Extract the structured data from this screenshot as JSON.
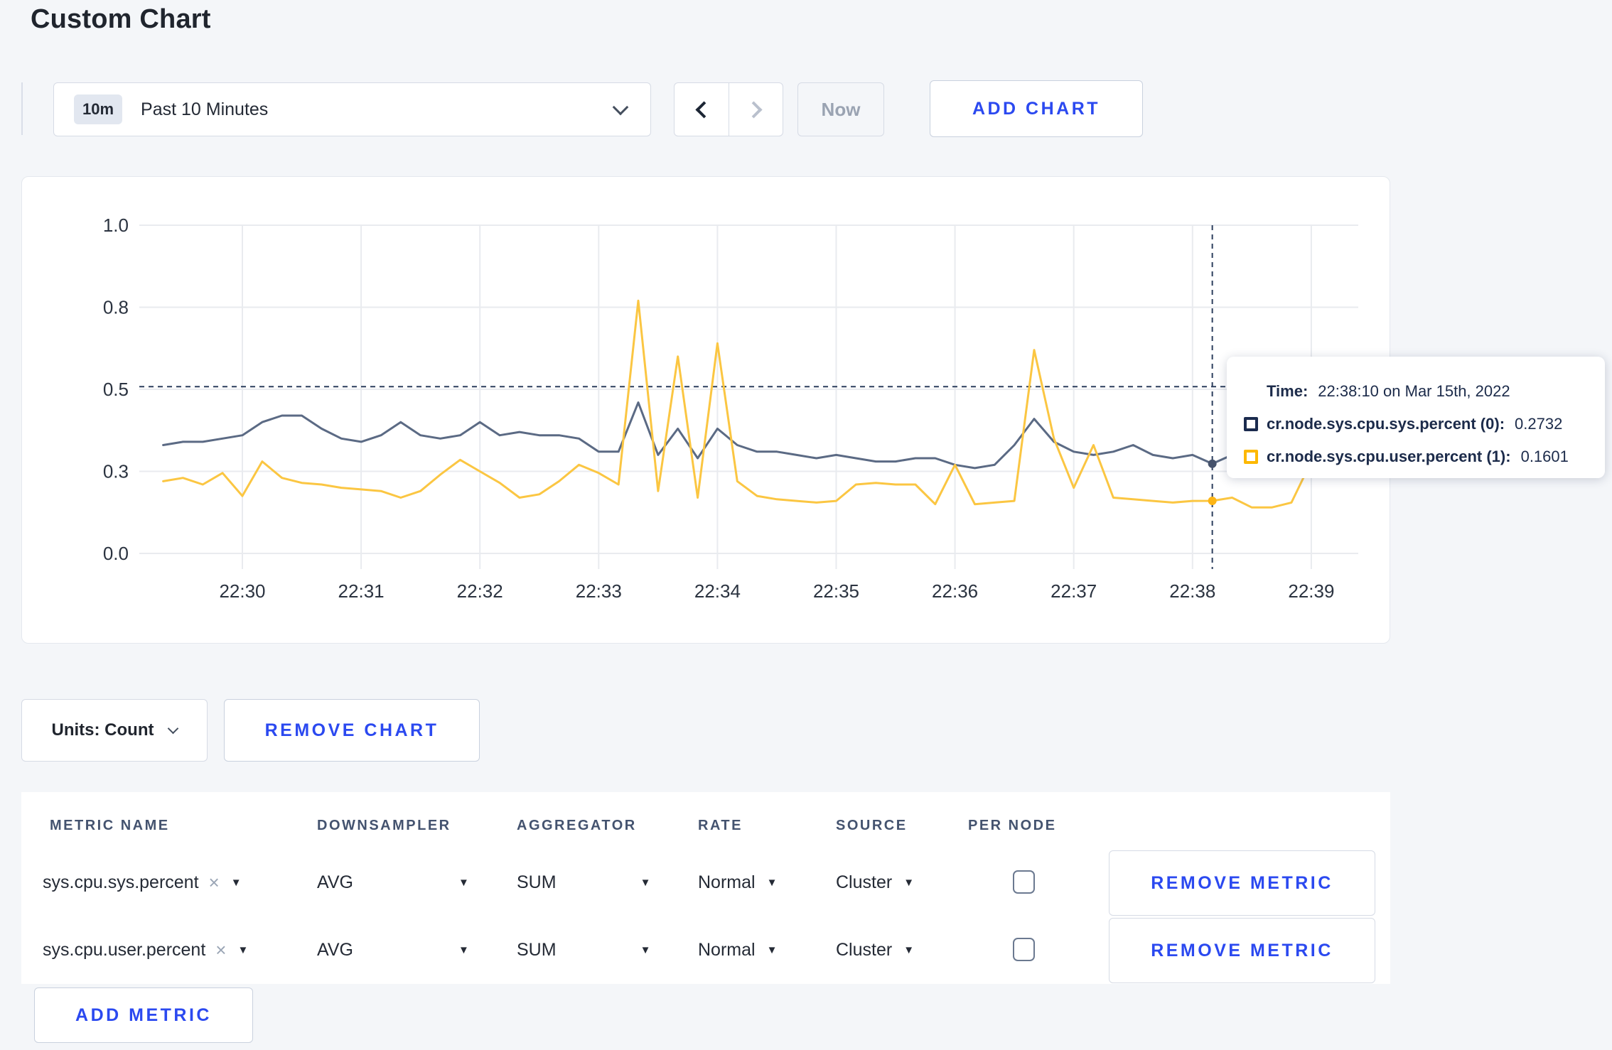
{
  "page": {
    "title": "Custom Chart"
  },
  "toolbar": {
    "time_window_badge": "10m",
    "time_window_label": "Past 10 Minutes",
    "now_label": "Now",
    "add_chart_label": "ADD CHART"
  },
  "chart_data": {
    "type": "line",
    "title": "",
    "xlabel": "",
    "ylabel": "",
    "x_start_label": "22:29:20",
    "x_interval_seconds": 10,
    "x_tick_labels": [
      "22:30",
      "22:31",
      "22:32",
      "22:33",
      "22:34",
      "22:35",
      "22:36",
      "22:37",
      "22:38",
      "22:39"
    ],
    "y_ticks": [
      0,
      0.25,
      0.5,
      0.75,
      1.0
    ],
    "y_tick_labels": [
      "0.0",
      "0.3",
      "0.5",
      "0.8",
      "1.0"
    ],
    "ylim": [
      0,
      1.0
    ],
    "grid": true,
    "series": [
      {
        "name": "cr.node.sys.cpu.sys.percent (0)",
        "color": "#5b6a84",
        "values": [
          0.33,
          0.34,
          0.34,
          0.35,
          0.36,
          0.4,
          0.42,
          0.42,
          0.38,
          0.35,
          0.34,
          0.36,
          0.4,
          0.36,
          0.35,
          0.36,
          0.4,
          0.36,
          0.37,
          0.36,
          0.36,
          0.35,
          0.31,
          0.31,
          0.46,
          0.3,
          0.38,
          0.29,
          0.38,
          0.33,
          0.31,
          0.31,
          0.3,
          0.29,
          0.3,
          0.29,
          0.28,
          0.28,
          0.29,
          0.29,
          0.27,
          0.26,
          0.27,
          0.33,
          0.41,
          0.34,
          0.31,
          0.3,
          0.31,
          0.33,
          0.3,
          0.29,
          0.3,
          0.2732,
          0.3,
          0.32,
          0.3,
          0.3,
          0.31,
          0.3
        ]
      },
      {
        "name": "cr.node.sys.cpu.user.percent (1)",
        "color": "#fbc642",
        "values": [
          0.22,
          0.23,
          0.21,
          0.245,
          0.175,
          0.28,
          0.23,
          0.215,
          0.21,
          0.2,
          0.195,
          0.19,
          0.17,
          0.19,
          0.24,
          0.285,
          0.25,
          0.215,
          0.17,
          0.18,
          0.22,
          0.27,
          0.245,
          0.21,
          0.77,
          0.19,
          0.6,
          0.17,
          0.64,
          0.22,
          0.175,
          0.165,
          0.16,
          0.155,
          0.16,
          0.21,
          0.215,
          0.21,
          0.21,
          0.15,
          0.27,
          0.15,
          0.155,
          0.16,
          0.62,
          0.35,
          0.2,
          0.33,
          0.17,
          0.165,
          0.16,
          0.155,
          0.16,
          0.1601,
          0.17,
          0.14,
          0.14,
          0.155,
          0.28,
          0.24
        ]
      }
    ],
    "crosshair": {
      "x_index": 53,
      "x_time": "22:38:10",
      "hover_y_value": 0.508,
      "dot_values": [
        0.2732,
        0.1601
      ]
    }
  },
  "tooltip": {
    "time_label": "Time:",
    "time_value": "22:38:10 on Mar 15th, 2022",
    "rows": [
      {
        "name": "cr.node.sys.cpu.sys.percent (0):",
        "value": "0.2732",
        "swatch_color": "#1b2b4e"
      },
      {
        "name": "cr.node.sys.cpu.user.percent (1):",
        "value": "0.1601",
        "swatch_color": "#fdb800"
      }
    ]
  },
  "chart_controls": {
    "units_label": "Units: Count",
    "remove_chart_label": "REMOVE CHART"
  },
  "metrics_table": {
    "headers": [
      "METRIC NAME",
      "DOWNSAMPLER",
      "AGGREGATOR",
      "RATE",
      "SOURCE",
      "PER NODE"
    ],
    "remove_icon": "×",
    "rows": [
      {
        "metric_name": "sys.cpu.sys.percent",
        "downsampler": "AVG",
        "aggregator": "SUM",
        "rate": "Normal",
        "source": "Cluster",
        "per_node_checked": false,
        "remove_label": "REMOVE METRIC"
      },
      {
        "metric_name": "sys.cpu.user.percent",
        "downsampler": "AVG",
        "aggregator": "SUM",
        "rate": "Normal",
        "source": "Cluster",
        "per_node_checked": false,
        "remove_label": "REMOVE METRIC"
      }
    ],
    "add_metric_label": "ADD METRIC"
  },
  "colors": {
    "accent_blue": "#2b49f0",
    "series_sys": "#5b6a84",
    "series_user": "#fbc642",
    "crosshair": "#2c3e5d",
    "grid": "#e9ebef"
  }
}
